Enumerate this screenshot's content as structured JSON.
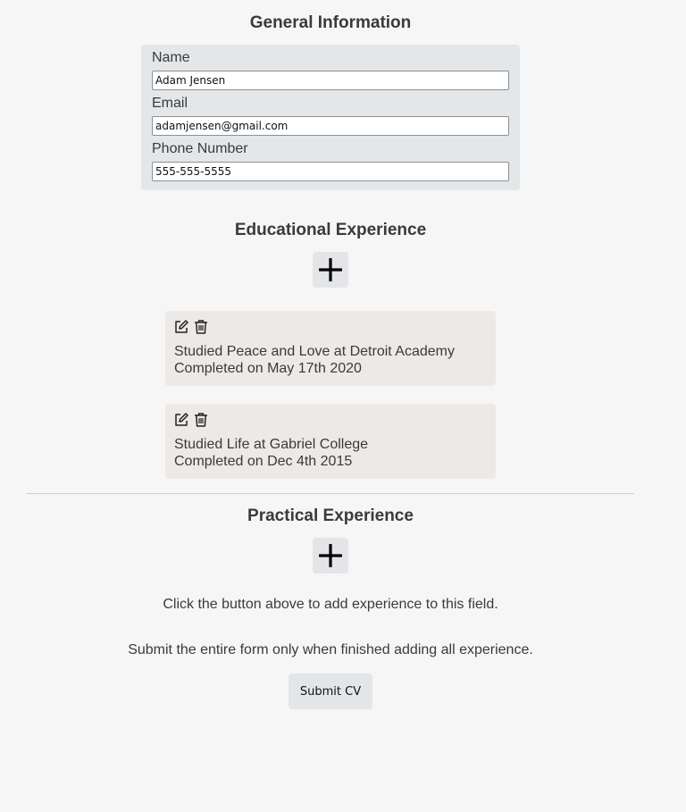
{
  "general": {
    "title": "General Information",
    "fields": [
      {
        "label": "Name",
        "value": "Adam Jensen"
      },
      {
        "label": "Email",
        "value": "adamjensen@gmail.com"
      },
      {
        "label": "Phone Number",
        "value": "555-555-5555"
      }
    ]
  },
  "education": {
    "title": "Educational Experience",
    "add_icon": "plus-icon",
    "entries": [
      {
        "line1": "Studied Peace and Love at Detroit Academy",
        "line2": "Completed on May 17th 2020"
      },
      {
        "line1": "Studied Life at Gabriel College",
        "line2": "Completed on Dec 4th 2015"
      }
    ],
    "entry_icons": [
      "edit-icon",
      "trash-icon"
    ]
  },
  "practical": {
    "title": "Practical Experience",
    "add_icon": "plus-icon",
    "hint": "Click the button above to add experience to this field."
  },
  "submit": {
    "note": "Submit the entire form only when finished adding all experience.",
    "label": "Submit CV"
  }
}
